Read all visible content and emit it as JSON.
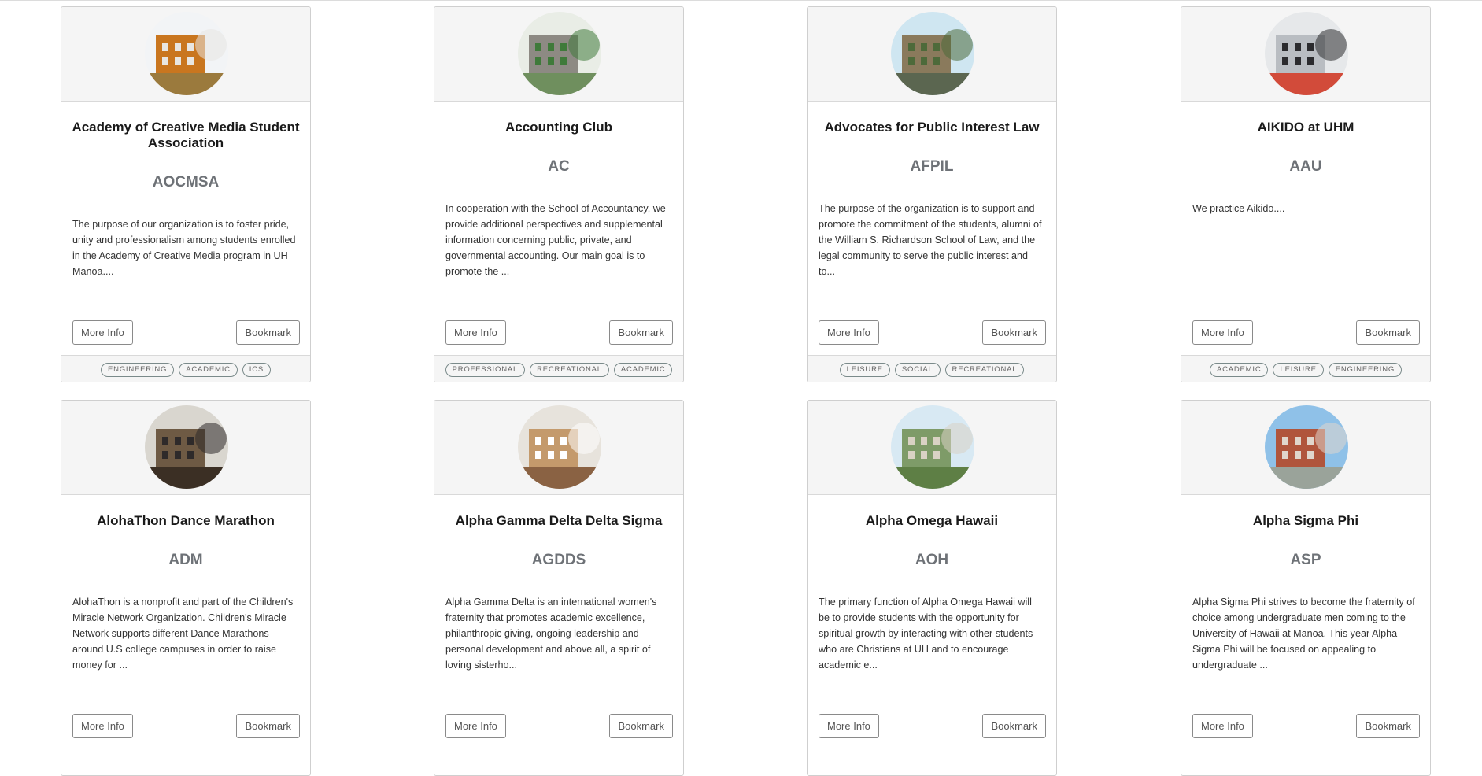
{
  "labels": {
    "more_info": "More Info",
    "bookmark": "Bookmark"
  },
  "clubs": [
    {
      "title": "Academy of Creative Media Student Association",
      "abbr": "AOCMSA",
      "description": "The purpose of our organization is to foster pride, unity and professionalism among students enrolled in the Academy of Creative Media program in UH Manoa....",
      "tags": [
        "ENGINEERING",
        "ACADEMIC",
        "ICS"
      ],
      "image": {
        "sky": "#f2f4f6",
        "main": "#c9761f",
        "accent": "#e8e6e2",
        "ground": "#9b7a3d"
      }
    },
    {
      "title": "Accounting Club",
      "abbr": "AC",
      "description": "In cooperation with the School of Accountancy, we provide additional perspectives and supplemental information concerning public, private, and governmental accounting. Our main goal is to promote the ...",
      "tags": [
        "PROFESSIONAL",
        "RECREATIONAL",
        "ACADEMIC"
      ],
      "image": {
        "sky": "#e9ede6",
        "main": "#8d8a83",
        "accent": "#3f7a3a",
        "ground": "#6f8f5e"
      }
    },
    {
      "title": "Advocates for Public Interest Law",
      "abbr": "AFPIL",
      "description": "The purpose of the organization is to support and promote the commitment of the students, alumni of the William S. Richardson School of Law, and the legal community to serve the public interest and to...",
      "tags": [
        "LEISURE",
        "SOCIAL",
        "RECREATIONAL"
      ],
      "image": {
        "sky": "#cfe6f1",
        "main": "#8a7a5c",
        "accent": "#4d6a3a",
        "ground": "#5b6650"
      }
    },
    {
      "title": "AIKIDO at UHM",
      "abbr": "AAU",
      "description": "We practice Aikido....",
      "tags": [
        "ACADEMIC",
        "LEISURE",
        "ENGINEERING"
      ],
      "image": {
        "sky": "#e6e8ea",
        "main": "#b9bdc2",
        "accent": "#2b2b2e",
        "ground": "#d24b3a"
      }
    },
    {
      "title": "AlohaThon Dance Marathon",
      "abbr": "ADM",
      "description": "AlohaThon is a nonprofit and part of the Children's Miracle Network Organization. Children's Miracle Network supports different Dance Marathons around U.S college campuses in order to raise money for ...",
      "tags": [],
      "image": {
        "sky": "#d9d6cf",
        "main": "#6e5a44",
        "accent": "#2e2a2a",
        "ground": "#3b2f24"
      }
    },
    {
      "title": "Alpha Gamma Delta Delta Sigma",
      "abbr": "AGDDS",
      "description": "Alpha Gamma Delta is an international women's fraternity that promotes academic excellence, philanthropic giving, ongoing leadership and personal development and above all, a spirit of loving sisterho...",
      "tags": [],
      "image": {
        "sky": "#e7e3dc",
        "main": "#c49a6c",
        "accent": "#ffffff",
        "ground": "#8a6243"
      }
    },
    {
      "title": "Alpha Omega Hawaii",
      "abbr": "AOH",
      "description": "The primary function of Alpha Omega Hawaii will be to provide students with the opportunity for spiritual growth by interacting with other students who are Christians at UH and to encourage academic e...",
      "tags": [],
      "image": {
        "sky": "#d8e9f3",
        "main": "#7e9b68",
        "accent": "#d9d2c4",
        "ground": "#5e7f45"
      }
    },
    {
      "title": "Alpha Sigma Phi",
      "abbr": "ASP",
      "description": "Alpha Sigma Phi strives to become the fraternity of choice among undergraduate men coming to the University of Hawaii at Manoa. This year Alpha Sigma Phi will be focused on appealing to undergraduate ...",
      "tags": [],
      "image": {
        "sky": "#8fc1e8",
        "main": "#b0553c",
        "accent": "#e0d6cc",
        "ground": "#9aa39a"
      }
    }
  ]
}
